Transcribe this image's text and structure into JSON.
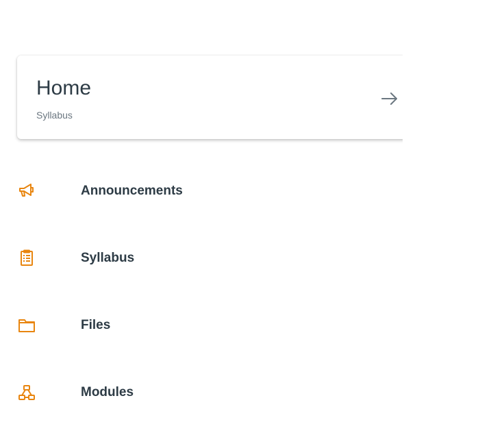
{
  "home_card": {
    "title": "Home",
    "subtitle": "Syllabus",
    "arrow_icon": "arrow-right-icon"
  },
  "menu": [
    {
      "label": "Announcements",
      "icon": "megaphone-icon"
    },
    {
      "label": "Syllabus",
      "icon": "syllabus-icon"
    },
    {
      "label": "Files",
      "icon": "folder-icon"
    },
    {
      "label": "Modules",
      "icon": "modules-icon"
    }
  ],
  "colors": {
    "accent": "#e8850f",
    "text": "#2d3b45",
    "subtext": "#6b7780"
  }
}
